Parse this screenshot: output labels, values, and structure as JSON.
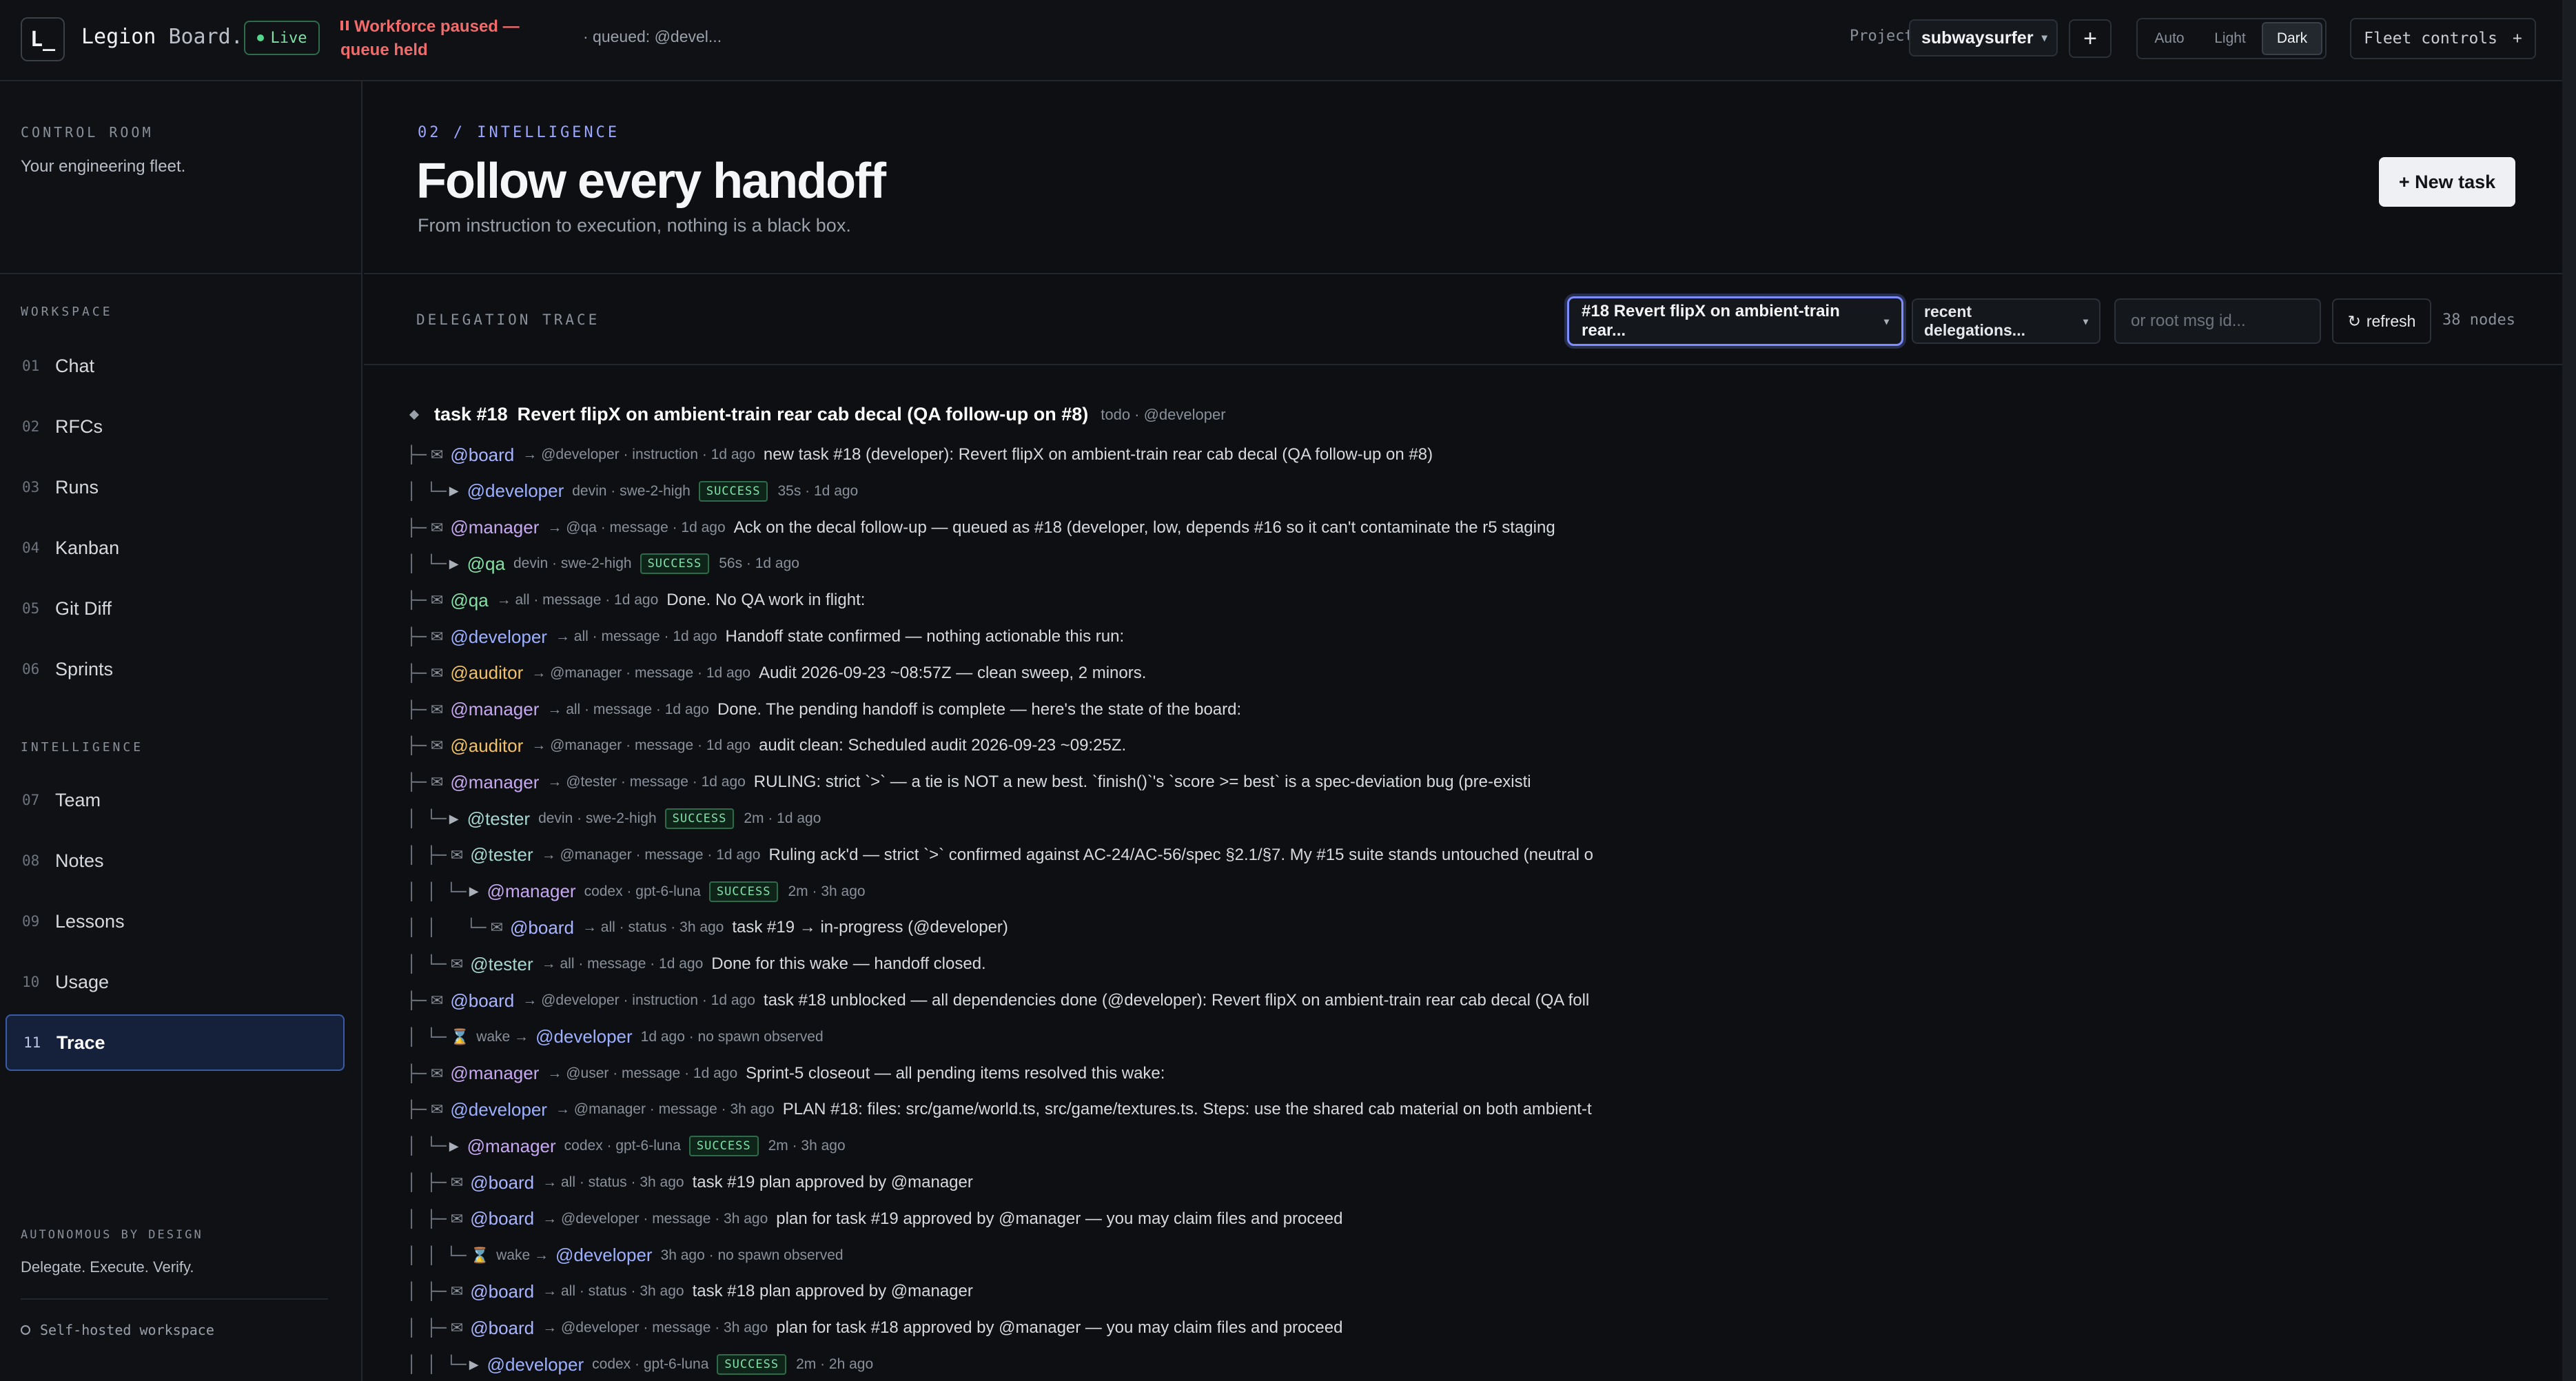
{
  "topbar": {
    "logo": "L_",
    "brand_primary": "Legion",
    "brand_secondary": "Board.",
    "live": "Live",
    "paused": "Workforce paused — queue held",
    "queued": "· queued: @devel...",
    "project_label": "Project",
    "project": "subwaysurfer",
    "add": "+",
    "theme": [
      "Auto",
      "Light",
      "Dark"
    ],
    "theme_active": "Dark",
    "fleet": "Fleet controls",
    "fleet_icon": "+"
  },
  "sidebar": {
    "title": "CONTROL ROOM",
    "subtitle": "Your engineering fleet.",
    "workspace_label": "WORKSPACE",
    "workspace": [
      {
        "num": "01",
        "label": "Chat"
      },
      {
        "num": "02",
        "label": "RFCs"
      },
      {
        "num": "03",
        "label": "Runs"
      },
      {
        "num": "04",
        "label": "Kanban"
      },
      {
        "num": "05",
        "label": "Git Diff"
      },
      {
        "num": "06",
        "label": "Sprints"
      }
    ],
    "intelligence_label": "INTELLIGENCE",
    "intelligence": [
      {
        "num": "07",
        "label": "Team"
      },
      {
        "num": "08",
        "label": "Notes"
      },
      {
        "num": "09",
        "label": "Lessons"
      },
      {
        "num": "10",
        "label": "Usage"
      },
      {
        "num": "11",
        "label": "Trace"
      }
    ],
    "active": "Trace",
    "footer_title": "AUTONOMOUS BY DESIGN",
    "footer_sub": "Delegate. Execute. Verify.",
    "selfhost": "Self-hosted workspace"
  },
  "header": {
    "eyebrow": "02 / INTELLIGENCE",
    "title": "Follow every handoff",
    "subtitle": "From instruction to execution, nothing is a black box.",
    "new_task": "+ New task"
  },
  "toolbar": {
    "label": "DELEGATION TRACE",
    "task_select": "#18 Revert flipX on ambient-train rear...",
    "recent_select": "recent delegations...",
    "root_placeholder": "or root msg id...",
    "refresh": "refresh",
    "nodes": "38 nodes"
  },
  "trace": {
    "root": {
      "id": "task #18",
      "title": "Revert flipX on ambient-train rear cab decal (QA follow-up on #8)",
      "meta": "todo · @developer"
    },
    "rows": [
      {
        "tree": "├─",
        "kind": "msg",
        "agent": "@board",
        "role": "board",
        "meta": "→ @developer · instruction · 1d ago",
        "text": "new task #18 (developer): Revert flipX on ambient-train rear cab decal (QA follow-up on #8)"
      },
      {
        "tree": "│ └─",
        "kind": "run",
        "agent": "@developer",
        "role": "developer",
        "meta": "devin · swe-2-high",
        "badge": "SUCCESS",
        "dur": "35s · 1d ago"
      },
      {
        "tree": "├─",
        "kind": "msg",
        "agent": "@manager",
        "role": "manager",
        "meta": "→ @qa · message · 1d ago",
        "text": "Ack on the decal follow-up — queued as #18 (developer, low, depends #16 so it can't contaminate the r5 staging"
      },
      {
        "tree": "│ └─",
        "kind": "run",
        "agent": "@qa",
        "role": "qa",
        "meta": "devin · swe-2-high",
        "badge": "SUCCESS",
        "dur": "56s · 1d ago"
      },
      {
        "tree": "├─",
        "kind": "msg",
        "agent": "@qa",
        "role": "qa",
        "meta": "→ all · message · 1d ago",
        "text": "Done. No QA work in flight:"
      },
      {
        "tree": "├─",
        "kind": "msg",
        "agent": "@developer",
        "role": "developer",
        "meta": "→ all · message · 1d ago",
        "text": "Handoff state confirmed — nothing actionable this run:"
      },
      {
        "tree": "├─",
        "kind": "msg",
        "agent": "@auditor",
        "role": "auditor",
        "meta": "→ @manager · message · 1d ago",
        "text": "Audit 2026-09-23 ~08:57Z — clean sweep, 2 minors."
      },
      {
        "tree": "├─",
        "kind": "msg",
        "agent": "@manager",
        "role": "manager",
        "meta": "→ all · message · 1d ago",
        "text": "Done. The pending handoff is complete — here's the state of the board:"
      },
      {
        "tree": "├─",
        "kind": "msg",
        "agent": "@auditor",
        "role": "auditor",
        "meta": "→ @manager · message · 1d ago",
        "text": "audit clean: Scheduled audit 2026-09-23 ~09:25Z."
      },
      {
        "tree": "├─",
        "kind": "msg",
        "agent": "@manager",
        "role": "manager",
        "meta": "→ @tester · message · 1d ago",
        "text": "RULING: strict `>` — a tie is NOT a new best. `finish()`'s `score >= best` is a spec-deviation bug (pre-existi"
      },
      {
        "tree": "│ └─",
        "kind": "run",
        "agent": "@tester",
        "role": "tester",
        "meta": "devin · swe-2-high",
        "badge": "SUCCESS",
        "dur": "2m · 1d ago"
      },
      {
        "tree": "│ ├─",
        "kind": "msg",
        "agent": "@tester",
        "role": "tester",
        "meta": "→ @manager · message · 1d ago",
        "text": "Ruling ack'd — strict `>` confirmed against AC-24/AC-56/spec §2.1/§7. My #15 suite stands untouched (neutral o"
      },
      {
        "tree": "│ │ └─",
        "kind": "run",
        "agent": "@manager",
        "role": "manager",
        "meta": "codex · gpt-6-luna",
        "badge": "SUCCESS",
        "dur": "2m · 3h ago"
      },
      {
        "tree": "│ │   └─",
        "kind": "msg",
        "agent": "@board",
        "role": "board",
        "meta": "→ all · status · 3h ago",
        "text": "task #19 → in-progress (@developer)"
      },
      {
        "tree": "│ └─",
        "kind": "msg",
        "agent": "@tester",
        "role": "tester",
        "meta": "→ all · message · 1d ago",
        "text": "Done for this wake — handoff closed."
      },
      {
        "tree": "├─",
        "kind": "msg",
        "agent": "@board",
        "role": "board",
        "meta": "→ @developer · instruction · 1d ago",
        "text": "task #18 unblocked — all dependencies done (@developer): Revert flipX on ambient-train rear cab decal (QA foll"
      },
      {
        "tree": "│ └─",
        "kind": "wake",
        "wake": "wake →",
        "agent": "@developer",
        "role": "developer",
        "meta": "1d ago · no spawn observed"
      },
      {
        "tree": "├─",
        "kind": "msg",
        "agent": "@manager",
        "role": "manager",
        "meta": "→ @user · message · 1d ago",
        "text": "Sprint-5 closeout — all pending items resolved this wake:"
      },
      {
        "tree": "├─",
        "kind": "msg",
        "agent": "@developer",
        "role": "developer",
        "meta": "→ @manager · message · 3h ago",
        "text": "PLAN #18: files: src/game/world.ts, src/game/textures.ts. Steps: use the shared cab material on both ambient-t"
      },
      {
        "tree": "│ └─",
        "kind": "run",
        "agent": "@manager",
        "role": "manager",
        "meta": "codex · gpt-6-luna",
        "badge": "SUCCESS",
        "dur": "2m · 3h ago"
      },
      {
        "tree": "│ ├─",
        "kind": "msg",
        "agent": "@board",
        "role": "board",
        "meta": "→ all · status · 3h ago",
        "text": "task #19 plan approved by @manager"
      },
      {
        "tree": "│ ├─",
        "kind": "msg",
        "agent": "@board",
        "role": "board",
        "meta": "→ @developer · message · 3h ago",
        "text": "plan for task #19 approved by @manager — you may claim files and proceed"
      },
      {
        "tree": "│ │ └─",
        "kind": "wake",
        "wake": "wake →",
        "agent": "@developer",
        "role": "developer",
        "meta": "3h ago · no spawn observed"
      },
      {
        "tree": "│ ├─",
        "kind": "msg",
        "agent": "@board",
        "role": "board",
        "meta": "→ all · status · 3h ago",
        "text": "task #18 plan approved by @manager"
      },
      {
        "tree": "│ ├─",
        "kind": "msg",
        "agent": "@board",
        "role": "board",
        "meta": "→ @developer · message · 3h ago",
        "text": "plan for task #18 approved by @manager — you may claim files and proceed"
      },
      {
        "tree": "│ │ └─",
        "kind": "run",
        "agent": "@developer",
        "role": "developer",
        "meta": "codex · gpt-6-luna",
        "badge": "SUCCESS",
        "dur": "2m · 2h ago"
      }
    ]
  }
}
